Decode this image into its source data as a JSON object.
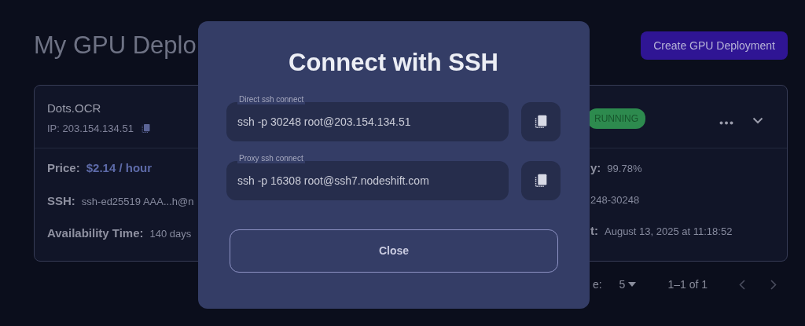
{
  "page": {
    "title": "My GPU Deplo",
    "create_button": "Create GPU Deployment"
  },
  "deployment": {
    "name": "Dots.OCR",
    "ip": "IP: 203.154.134.51",
    "status": "RUNNING",
    "fields": [
      {
        "label": "Price:",
        "value": "$2.14 / hour",
        "accent": true
      },
      {
        "label": "SSH:",
        "value": "ssh-ed25519 AAA...h@n",
        "accent": false
      },
      {
        "label": "Availability Time:",
        "value": "140 days",
        "accent": false
      }
    ],
    "right_fields": [
      {
        "label": "y:",
        "value": "99.78%"
      },
      {
        "value": "248-30248"
      },
      {
        "label": "t:",
        "value": "August 13, 2025 at 11:18:52"
      }
    ]
  },
  "pagination": {
    "label": "e:",
    "per_page": "5",
    "range": "1–1 of 1"
  },
  "modal": {
    "title": "Connect with SSH",
    "fields": [
      {
        "label": "Direct ssh connect",
        "value": "ssh -p 30248 root@203.154.134.51"
      },
      {
        "label": "Proxy ssh connect",
        "value": "ssh -p 16308 root@ssh7.nodeshift.com"
      }
    ],
    "close": "Close"
  }
}
